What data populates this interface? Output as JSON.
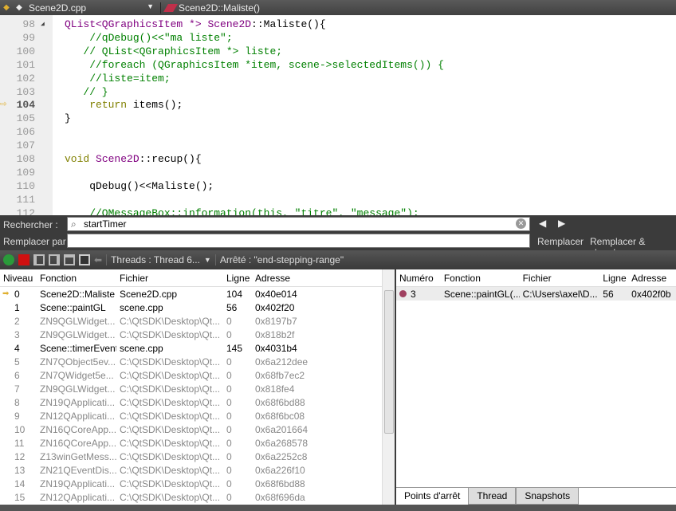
{
  "topbar": {
    "file": "Scene2D.cpp",
    "function": "Scene2D::Maliste()"
  },
  "editor": {
    "current_line": "104",
    "lines": [
      {
        "n": "98",
        "segs": [
          [
            "QList<QGraphicsItem *> ",
            "t"
          ],
          [
            "Scene2D",
            "t"
          ],
          [
            "::Maliste(){",
            "p"
          ]
        ]
      },
      {
        "n": "99",
        "segs": [
          [
            "    //qDebug()<<\"ma liste\";",
            "c"
          ]
        ]
      },
      {
        "n": "100",
        "segs": [
          [
            "   // QList<QGraphicsItem *> liste;",
            "c"
          ]
        ]
      },
      {
        "n": "101",
        "segs": [
          [
            "    //foreach (QGraphicsItem *item, scene->selectedItems()) {",
            "c"
          ]
        ]
      },
      {
        "n": "102",
        "segs": [
          [
            "    //liste=item;",
            "c"
          ]
        ]
      },
      {
        "n": "103",
        "segs": [
          [
            "   // }",
            "c"
          ]
        ]
      },
      {
        "n": "104",
        "segs": [
          [
            "    ",
            "p"
          ],
          [
            "return",
            "k"
          ],
          [
            " items();",
            "p"
          ]
        ]
      },
      {
        "n": "105",
        "segs": [
          [
            "}",
            "p"
          ]
        ]
      },
      {
        "n": "106",
        "segs": []
      },
      {
        "n": "107",
        "segs": []
      },
      {
        "n": "108",
        "segs": [
          [
            "void",
            "k"
          ],
          [
            " ",
            "p"
          ],
          [
            "Scene2D",
            "t"
          ],
          [
            "::recup(){",
            "p"
          ]
        ]
      },
      {
        "n": "109",
        "segs": []
      },
      {
        "n": "110",
        "segs": [
          [
            "    qDebug()<<Maliste();",
            "p"
          ]
        ]
      },
      {
        "n": "111",
        "segs": []
      },
      {
        "n": "112",
        "segs": [
          [
            "    //QMessageBox::information(this, \"titre\", \"message\");",
            "c"
          ]
        ]
      }
    ]
  },
  "find": {
    "search_label": "Rechercher :",
    "search_value": "startTimer",
    "replace_label": "Remplacer par :",
    "replace_value": "",
    "replace_btn": "Remplacer",
    "replace_find_btn": "Remplacer & chercher"
  },
  "debug_toolbar": {
    "threads": "Threads : Thread 6...",
    "status": "Arrêté : \"end-stepping-range\""
  },
  "stack": {
    "headers": [
      "Niveau",
      "Fonction",
      "Fichier",
      "Ligne",
      "Adresse"
    ],
    "rows": [
      [
        "0",
        "Scene2D::Maliste",
        "Scene2D.cpp",
        "104",
        "0x40e014",
        true
      ],
      [
        "1",
        "Scene::paintGL",
        "scene.cpp",
        "56",
        "0x402f20",
        true
      ],
      [
        "2",
        "ZN9QGLWidget...",
        "C:\\QtSDK\\Desktop\\Qt...",
        "0",
        "0x8197b7",
        false
      ],
      [
        "3",
        "ZN9QGLWidget...",
        "C:\\QtSDK\\Desktop\\Qt...",
        "0",
        "0x818b2f",
        false
      ],
      [
        "4",
        "Scene::timerEvent",
        "scene.cpp",
        "145",
        "0x4031b4",
        true
      ],
      [
        "5",
        "ZN7QObject5ev...",
        "C:\\QtSDK\\Desktop\\Qt...",
        "0",
        "0x6a212dee",
        false
      ],
      [
        "6",
        "ZN7QWidget5e...",
        "C:\\QtSDK\\Desktop\\Qt...",
        "0",
        "0x68fb7ec2",
        false
      ],
      [
        "7",
        "ZN9QGLWidget...",
        "C:\\QtSDK\\Desktop\\Qt...",
        "0",
        "0x818fe4",
        false
      ],
      [
        "8",
        "ZN19QApplicati...",
        "C:\\QtSDK\\Desktop\\Qt...",
        "0",
        "0x68f6bd88",
        false
      ],
      [
        "9",
        "ZN12QApplicati...",
        "C:\\QtSDK\\Desktop\\Qt...",
        "0",
        "0x68f6bc08",
        false
      ],
      [
        "10",
        "ZN16QCoreApp...",
        "C:\\QtSDK\\Desktop\\Qt...",
        "0",
        "0x6a201664",
        false
      ],
      [
        "11",
        "ZN16QCoreApp...",
        "C:\\QtSDK\\Desktop\\Qt...",
        "0",
        "0x6a268578",
        false
      ],
      [
        "12",
        "Z13winGetMess...",
        "C:\\QtSDK\\Desktop\\Qt...",
        "0",
        "0x6a2252c8",
        false
      ],
      [
        "13",
        "ZN21QEventDis...",
        "C:\\QtSDK\\Desktop\\Qt...",
        "0",
        "0x6a226f10",
        false
      ],
      [
        "14",
        "ZN19QApplicati...",
        "C:\\QtSDK\\Desktop\\Qt...",
        "0",
        "0x68f6bd88",
        false
      ],
      [
        "15",
        "ZN12QApplicati...",
        "C:\\QtSDK\\Desktop\\Qt...",
        "0",
        "0x68f696da",
        false
      ]
    ]
  },
  "breakpoints": {
    "headers": [
      "Numéro",
      "Fonction",
      "Fichier",
      "Ligne",
      "Adresse"
    ],
    "rows": [
      [
        "3",
        "Scene::paintGL(...",
        "C:\\Users\\axel\\D...",
        "56",
        "0x402f0b"
      ]
    ],
    "tabs": [
      "Points d'arrêt",
      "Thread",
      "Snapshots"
    ],
    "active_tab": 0
  }
}
